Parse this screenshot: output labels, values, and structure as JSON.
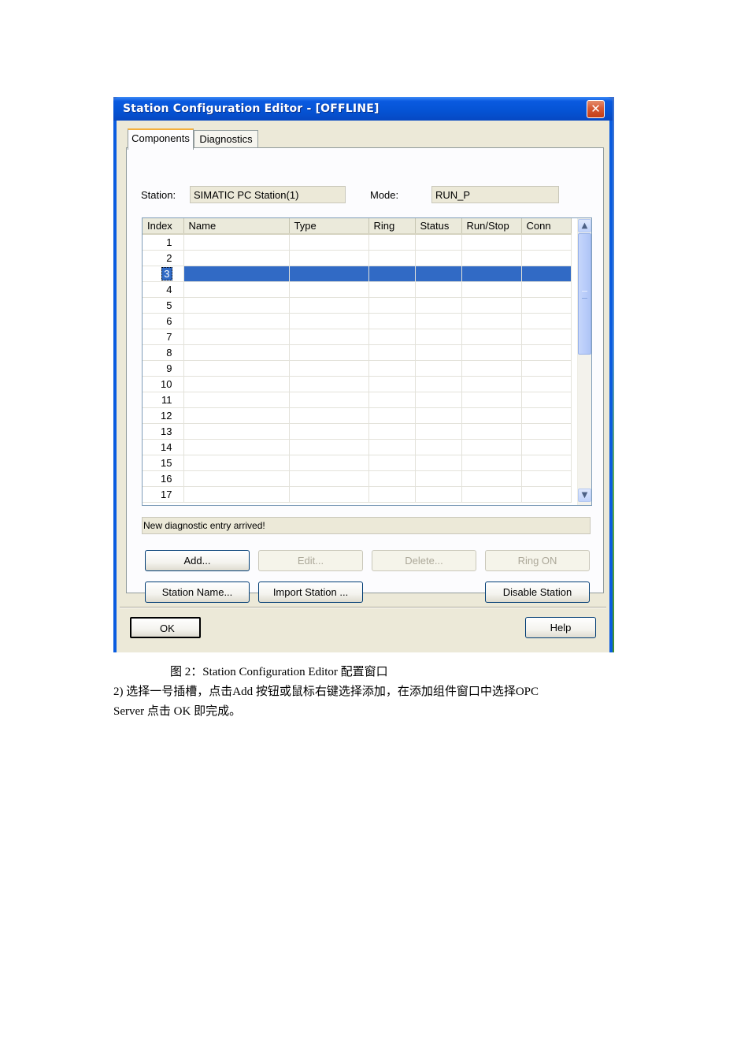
{
  "window": {
    "title": "Station Configuration Editor - [OFFLINE]",
    "close_glyph": "✕"
  },
  "tabs": [
    {
      "label": "Components",
      "active": true
    },
    {
      "label": "Diagnostics",
      "active": false
    }
  ],
  "station": {
    "label": "Station:",
    "value": "SIMATIC PC Station(1)"
  },
  "mode": {
    "label": "Mode:",
    "value": "RUN_P"
  },
  "grid": {
    "columns": [
      "Index",
      "Name",
      "Type",
      "Ring",
      "Status",
      "Run/Stop",
      "Conn"
    ],
    "rows": [
      "1",
      "2",
      "3",
      "4",
      "5",
      "6",
      "7",
      "8",
      "9",
      "10",
      "11",
      "12",
      "13",
      "14",
      "15",
      "16",
      "17"
    ],
    "selected_index": "3"
  },
  "scrollbar": {
    "up_icon": "▲",
    "down_icon": "▼"
  },
  "status_text": "New diagnostic entry arrived!",
  "buttons": {
    "add": "Add...",
    "edit": "Edit...",
    "delete": "Delete...",
    "ring_on": "Ring ON",
    "station_name": "Station Name...",
    "import_station": "Import Station ...",
    "disable_station": "Disable Station",
    "ok": "OK",
    "help": "Help"
  },
  "document": {
    "caption": "图 2：Station Configuration Editor  配置窗口",
    "line1": "2)  选择一号插槽，点击Add  按钮或鼠标右键选择添加，在添加组件窗口中选择OPC",
    "line2": "Server  点击 OK  即完成。"
  },
  "colors": {
    "titlebar": "#0553d4",
    "selection": "#316ac5",
    "dialog_bg": "#ece9d8"
  }
}
